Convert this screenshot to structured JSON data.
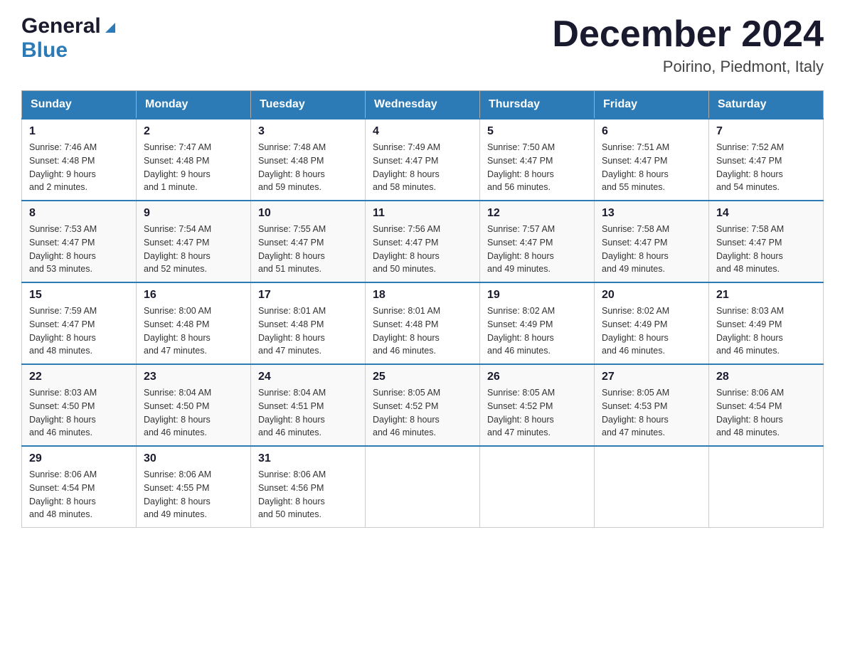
{
  "header": {
    "logo_general": "General",
    "logo_blue": "Blue",
    "month_title": "December 2024",
    "location": "Poirino, Piedmont, Italy"
  },
  "days_of_week": [
    "Sunday",
    "Monday",
    "Tuesday",
    "Wednesday",
    "Thursday",
    "Friday",
    "Saturday"
  ],
  "weeks": [
    [
      {
        "day": "1",
        "sunrise": "7:46 AM",
        "sunset": "4:48 PM",
        "daylight": "9 hours and 2 minutes."
      },
      {
        "day": "2",
        "sunrise": "7:47 AM",
        "sunset": "4:48 PM",
        "daylight": "9 hours and 1 minute."
      },
      {
        "day": "3",
        "sunrise": "7:48 AM",
        "sunset": "4:48 PM",
        "daylight": "8 hours and 59 minutes."
      },
      {
        "day": "4",
        "sunrise": "7:49 AM",
        "sunset": "4:47 PM",
        "daylight": "8 hours and 58 minutes."
      },
      {
        "day": "5",
        "sunrise": "7:50 AM",
        "sunset": "4:47 PM",
        "daylight": "8 hours and 56 minutes."
      },
      {
        "day": "6",
        "sunrise": "7:51 AM",
        "sunset": "4:47 PM",
        "daylight": "8 hours and 55 minutes."
      },
      {
        "day": "7",
        "sunrise": "7:52 AM",
        "sunset": "4:47 PM",
        "daylight": "8 hours and 54 minutes."
      }
    ],
    [
      {
        "day": "8",
        "sunrise": "7:53 AM",
        "sunset": "4:47 PM",
        "daylight": "8 hours and 53 minutes."
      },
      {
        "day": "9",
        "sunrise": "7:54 AM",
        "sunset": "4:47 PM",
        "daylight": "8 hours and 52 minutes."
      },
      {
        "day": "10",
        "sunrise": "7:55 AM",
        "sunset": "4:47 PM",
        "daylight": "8 hours and 51 minutes."
      },
      {
        "day": "11",
        "sunrise": "7:56 AM",
        "sunset": "4:47 PM",
        "daylight": "8 hours and 50 minutes."
      },
      {
        "day": "12",
        "sunrise": "7:57 AM",
        "sunset": "4:47 PM",
        "daylight": "8 hours and 49 minutes."
      },
      {
        "day": "13",
        "sunrise": "7:58 AM",
        "sunset": "4:47 PM",
        "daylight": "8 hours and 49 minutes."
      },
      {
        "day": "14",
        "sunrise": "7:58 AM",
        "sunset": "4:47 PM",
        "daylight": "8 hours and 48 minutes."
      }
    ],
    [
      {
        "day": "15",
        "sunrise": "7:59 AM",
        "sunset": "4:47 PM",
        "daylight": "8 hours and 48 minutes."
      },
      {
        "day": "16",
        "sunrise": "8:00 AM",
        "sunset": "4:48 PM",
        "daylight": "8 hours and 47 minutes."
      },
      {
        "day": "17",
        "sunrise": "8:01 AM",
        "sunset": "4:48 PM",
        "daylight": "8 hours and 47 minutes."
      },
      {
        "day": "18",
        "sunrise": "8:01 AM",
        "sunset": "4:48 PM",
        "daylight": "8 hours and 46 minutes."
      },
      {
        "day": "19",
        "sunrise": "8:02 AM",
        "sunset": "4:49 PM",
        "daylight": "8 hours and 46 minutes."
      },
      {
        "day": "20",
        "sunrise": "8:02 AM",
        "sunset": "4:49 PM",
        "daylight": "8 hours and 46 minutes."
      },
      {
        "day": "21",
        "sunrise": "8:03 AM",
        "sunset": "4:49 PM",
        "daylight": "8 hours and 46 minutes."
      }
    ],
    [
      {
        "day": "22",
        "sunrise": "8:03 AM",
        "sunset": "4:50 PM",
        "daylight": "8 hours and 46 minutes."
      },
      {
        "day": "23",
        "sunrise": "8:04 AM",
        "sunset": "4:50 PM",
        "daylight": "8 hours and 46 minutes."
      },
      {
        "day": "24",
        "sunrise": "8:04 AM",
        "sunset": "4:51 PM",
        "daylight": "8 hours and 46 minutes."
      },
      {
        "day": "25",
        "sunrise": "8:05 AM",
        "sunset": "4:52 PM",
        "daylight": "8 hours and 46 minutes."
      },
      {
        "day": "26",
        "sunrise": "8:05 AM",
        "sunset": "4:52 PM",
        "daylight": "8 hours and 47 minutes."
      },
      {
        "day": "27",
        "sunrise": "8:05 AM",
        "sunset": "4:53 PM",
        "daylight": "8 hours and 47 minutes."
      },
      {
        "day": "28",
        "sunrise": "8:06 AM",
        "sunset": "4:54 PM",
        "daylight": "8 hours and 48 minutes."
      }
    ],
    [
      {
        "day": "29",
        "sunrise": "8:06 AM",
        "sunset": "4:54 PM",
        "daylight": "8 hours and 48 minutes."
      },
      {
        "day": "30",
        "sunrise": "8:06 AM",
        "sunset": "4:55 PM",
        "daylight": "8 hours and 49 minutes."
      },
      {
        "day": "31",
        "sunrise": "8:06 AM",
        "sunset": "4:56 PM",
        "daylight": "8 hours and 50 minutes."
      },
      null,
      null,
      null,
      null
    ]
  ],
  "labels": {
    "sunrise": "Sunrise:",
    "sunset": "Sunset:",
    "daylight": "Daylight:"
  }
}
